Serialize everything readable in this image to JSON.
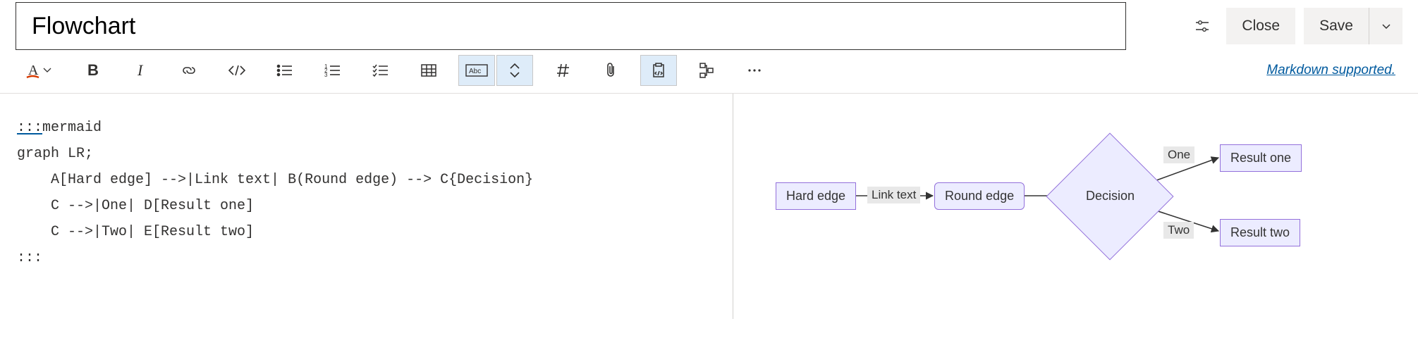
{
  "header": {
    "title_value": "Flowchart",
    "close_label": "Close",
    "save_label": "Save"
  },
  "toolbar": {
    "markdown_link": "Markdown supported."
  },
  "editor": {
    "line1_opener": ":::",
    "line1_rest": "mermaid",
    "line2": "graph LR;",
    "line3": "    A[Hard edge] -->|Link text| B(Round edge) --> C{Decision}",
    "line4": "    C -->|One| D[Result one]",
    "line5": "    C -->|Two| E[Result two]",
    "line6": ":::"
  },
  "diagram": {
    "node_a": "Hard edge",
    "edge_ab": "Link text",
    "node_b": "Round edge",
    "node_c": "Decision",
    "edge_cd": "One",
    "node_d": "Result one",
    "edge_ce": "Two",
    "node_e": "Result two"
  }
}
